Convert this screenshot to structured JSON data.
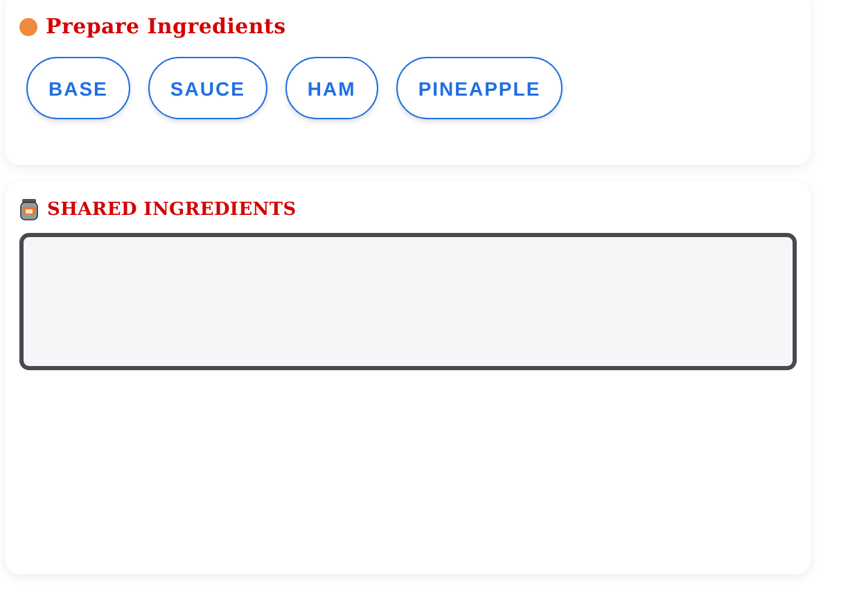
{
  "prepare": {
    "title": "Prepare Ingredients",
    "buttons": [
      "BASE",
      "SAUCE",
      "HAM",
      "PINEAPPLE"
    ]
  },
  "shared": {
    "title": "SHARED INGREDIENTS"
  }
}
